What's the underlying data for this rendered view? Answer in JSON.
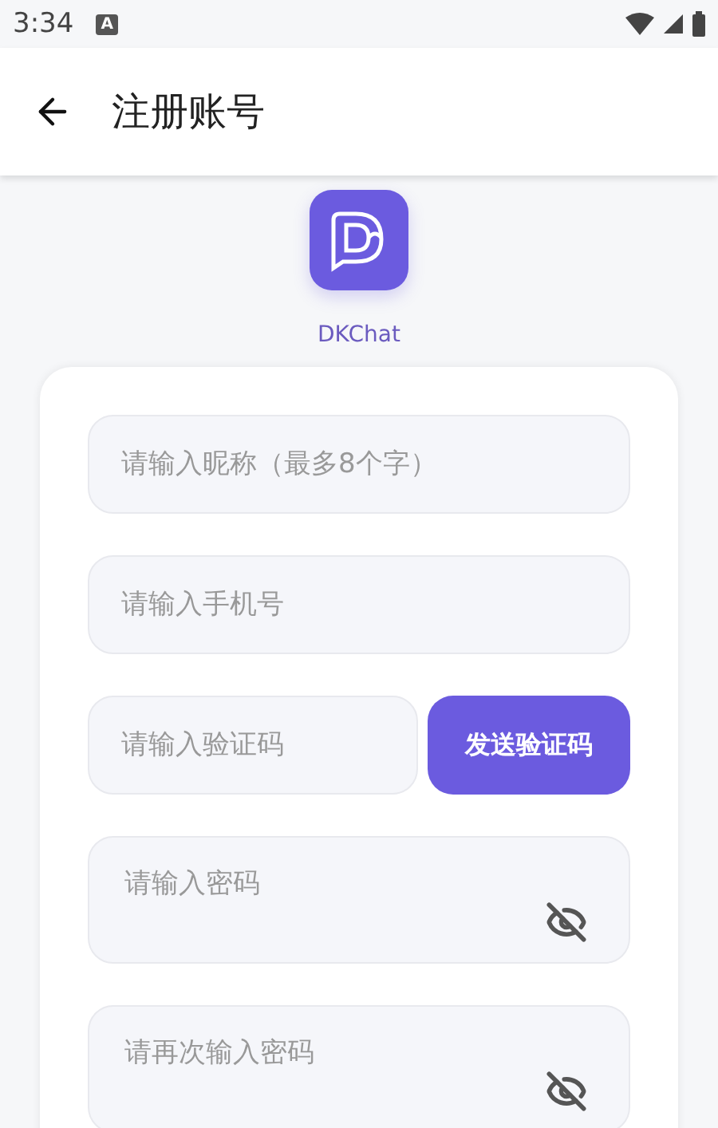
{
  "status_bar": {
    "time": "3:34",
    "notification": "A"
  },
  "app_bar": {
    "title": "注册账号"
  },
  "app": {
    "name": "DKChat"
  },
  "fields": [
    {
      "kind": "text",
      "placeholder": "请输入昵称（最多8个字）"
    },
    {
      "kind": "text",
      "placeholder": "请输入手机号"
    },
    {
      "kind": "code",
      "placeholder": "请输入验证码",
      "button": "发送验证码"
    },
    {
      "kind": "password",
      "placeholder": "请输入密码",
      "visible": false
    },
    {
      "kind": "password",
      "placeholder": "请再次输入密码",
      "visible": false
    }
  ]
}
